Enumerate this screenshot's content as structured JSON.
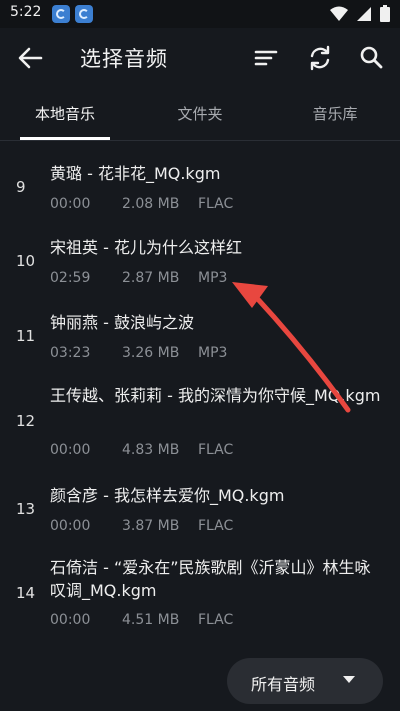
{
  "status": {
    "time": "5:22"
  },
  "header": {
    "title": "选择音频"
  },
  "tabs": [
    {
      "label": "本地音乐",
      "active": true
    },
    {
      "label": "文件夹",
      "active": false
    },
    {
      "label": "音乐库",
      "active": false
    }
  ],
  "tracks": [
    {
      "number": "9",
      "title": "黄璐 - 花非花_MQ.kgm",
      "duration": "00:00",
      "size": "2.08 MB",
      "format": "FLAC"
    },
    {
      "number": "10",
      "title": "宋祖英 - 花儿为什么这样红",
      "duration": "02:59",
      "size": "2.87 MB",
      "format": "MP3"
    },
    {
      "number": "11",
      "title": "钟丽燕 - 鼓浪屿之波",
      "duration": "03:23",
      "size": "3.26 MB",
      "format": "MP3"
    },
    {
      "number": "12",
      "title": "王传越、张莉莉 - 我的深情为你守候_MQ.kgm",
      "duration": "00:00",
      "size": "4.83 MB",
      "format": "FLAC"
    },
    {
      "number": "13",
      "title": "颜含彦 - 我怎样去爱你_MQ.kgm",
      "duration": "00:00",
      "size": "3.87 MB",
      "format": "FLAC"
    },
    {
      "number": "14",
      "title": "石倚洁 - “爱永在”民族歌剧《沂蒙山》林生咏叹调_MQ.kgm",
      "duration": "00:00",
      "size": "4.51 MB",
      "format": "FLAC"
    }
  ],
  "filter": {
    "label": "所有音频"
  },
  "colors": {
    "annotation_arrow": "#e8473f",
    "background": "#16191e"
  },
  "icons": [
    "back-arrow-icon",
    "sort-icon",
    "refresh-icon",
    "search-icon",
    "dropdown-caret-icon"
  ]
}
